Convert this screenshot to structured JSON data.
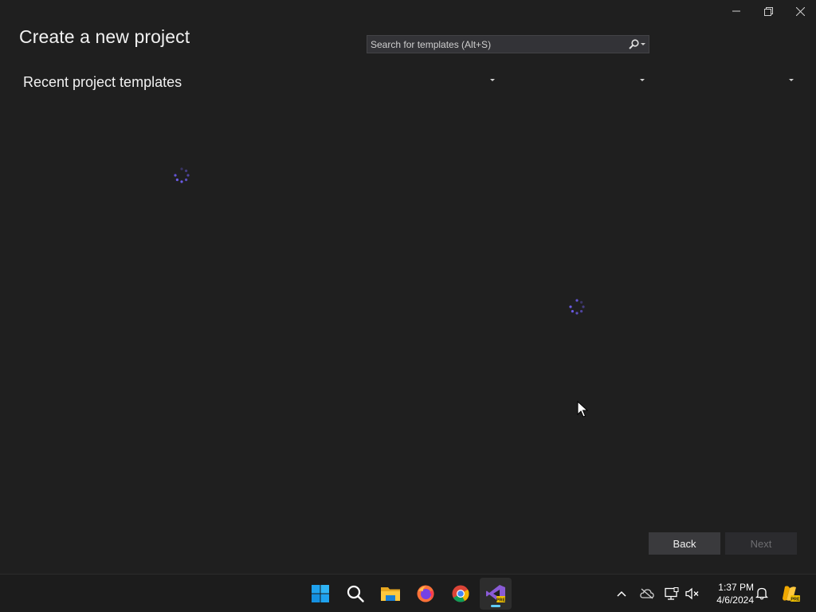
{
  "window": {
    "title_controls": [
      "minimize-icon",
      "restore-icon",
      "close-icon"
    ]
  },
  "page": {
    "title": "Create a new project",
    "recent_section_title": "Recent project templates"
  },
  "search": {
    "placeholder": "Search for templates (Alt+S)",
    "value": "",
    "icon": "search-icon"
  },
  "filters": [
    {
      "selected": ""
    },
    {
      "selected": ""
    },
    {
      "selected": ""
    }
  ],
  "footer": {
    "back_label": "Back",
    "next_label": "Next"
  },
  "taskbar": {
    "apps": [
      "windows-start-icon",
      "search-icon",
      "file-explorer-icon",
      "firefox-icon",
      "chrome-icon",
      "visual-studio-preview-icon"
    ],
    "active_app": "visual-studio-preview-icon",
    "tray": [
      "chevron-up-icon",
      "onedrive-icon",
      "network-icon",
      "volume-muted-icon"
    ],
    "time": "1:37 PM",
    "date": "4/6/2024"
  },
  "colors": {
    "background": "#1f1f1f",
    "spinner": "#6b5be6",
    "taskbar": "#1c1c1c",
    "accent": "#60cdff"
  }
}
